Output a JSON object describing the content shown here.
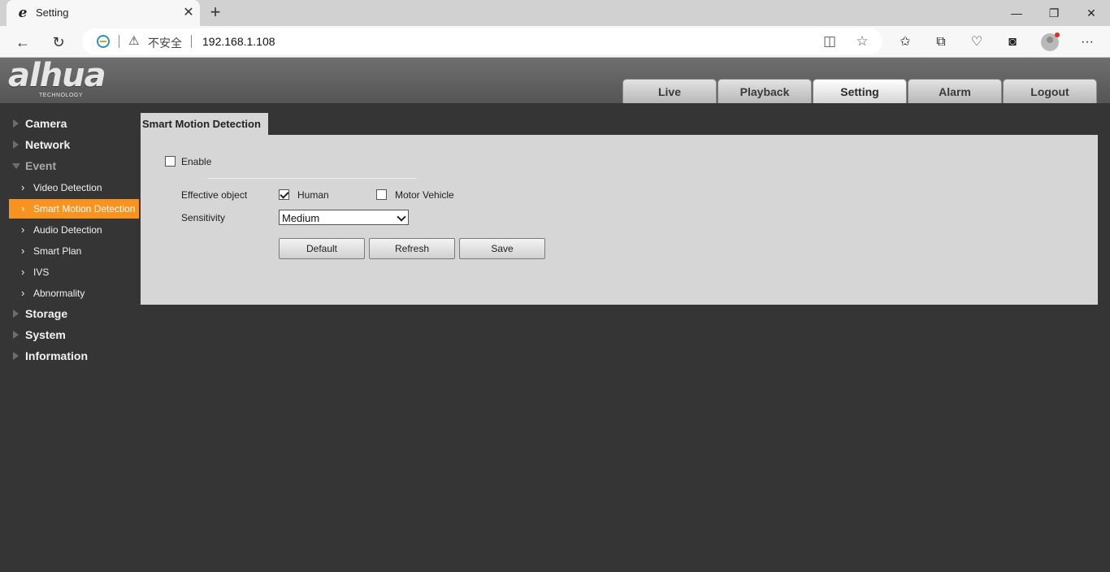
{
  "browser": {
    "tab_title": "Setting",
    "tab_favicon": "e",
    "security_label": "不安全",
    "url": "192.168.1.108",
    "icons": [
      "edge-favicon-icon",
      "close-tab-icon",
      "new-tab-icon",
      "minimize-icon",
      "maximize-icon",
      "window-close-icon",
      "back-icon",
      "refresh-icon",
      "ie-mode-icon",
      "warning-icon",
      "reader-view-icon",
      "favorite-star-icon",
      "favorites-list-icon",
      "collections-icon",
      "performance-icon",
      "edge-bar-icon",
      "profile-avatar-icon",
      "more-options-icon"
    ]
  },
  "header": {
    "logo_text": "alhua",
    "logo_subtitle": "TECHNOLOGY",
    "tabs": [
      {
        "label": "Live",
        "active": false
      },
      {
        "label": "Playback",
        "active": false
      },
      {
        "label": "Setting",
        "active": true
      },
      {
        "label": "Alarm",
        "active": false
      },
      {
        "label": "Logout",
        "active": false
      }
    ]
  },
  "sidebar": {
    "camera": "Camera",
    "network": "Network",
    "event": "Event",
    "event_items": [
      {
        "label": "Video Detection",
        "active": false
      },
      {
        "label": "Smart Motion Detection",
        "active": true
      },
      {
        "label": "Audio Detection",
        "active": false
      },
      {
        "label": "Smart Plan",
        "active": false
      },
      {
        "label": "IVS",
        "active": false
      },
      {
        "label": "Abnormality",
        "active": false
      }
    ],
    "storage": "Storage",
    "system": "System",
    "information": "Information"
  },
  "content": {
    "title": "Smart Motion Detection",
    "enable_label": "Enable",
    "enable_checked": false,
    "effective_object_label": "Effective object",
    "human_label": "Human",
    "human_checked": true,
    "motor_vehicle_label": "Motor Vehicle",
    "motor_vehicle_checked": false,
    "sensitivity_label": "Sensitivity",
    "sensitivity_value": "Medium",
    "buttons": {
      "default": "Default",
      "refresh": "Refresh",
      "save": "Save"
    }
  },
  "colors": {
    "accent": "#f7931e",
    "page_background": "#353535",
    "panel_background": "#d6d6d6"
  }
}
